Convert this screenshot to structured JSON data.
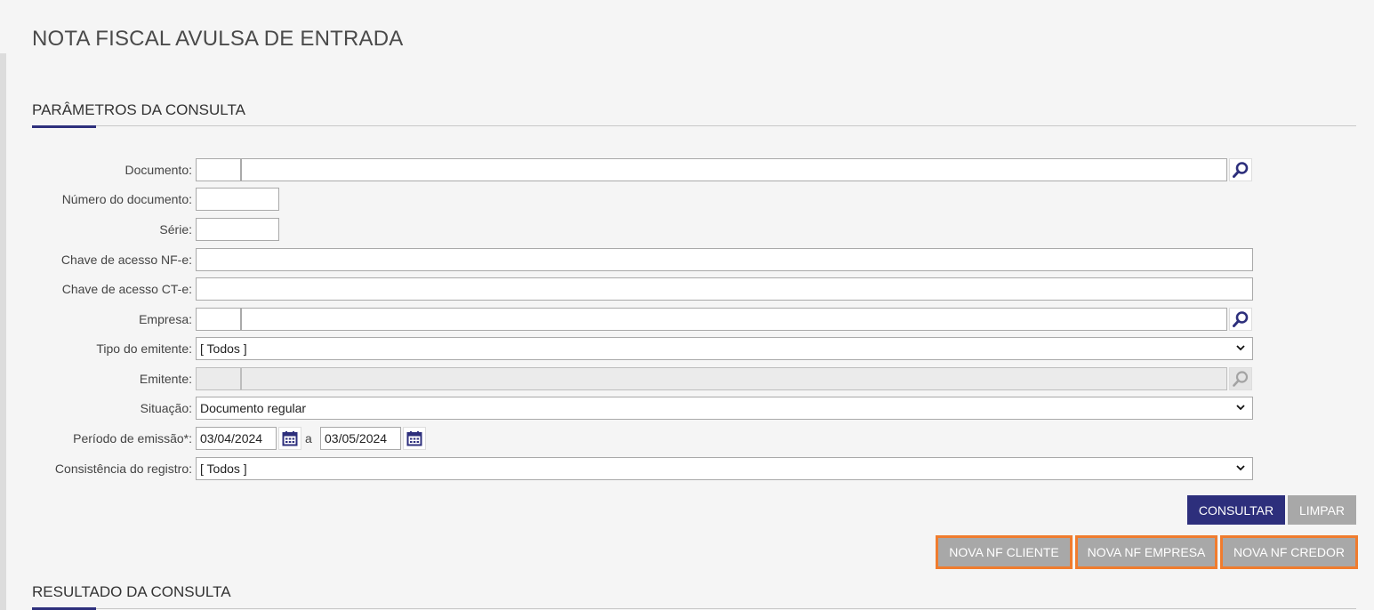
{
  "page": {
    "title": "NOTA FISCAL AVULSA DE ENTRADA"
  },
  "sections": {
    "params_title": "PARÂMETROS DA CONSULTA",
    "results_title": "RESULTADO DA CONSULTA"
  },
  "form": {
    "documento": {
      "label": "Documento:",
      "code": "",
      "value": ""
    },
    "numero": {
      "label": "Número do documento:",
      "value": ""
    },
    "serie": {
      "label": "Série:",
      "value": ""
    },
    "chave_nfe": {
      "label": "Chave de acesso NF-e:",
      "value": ""
    },
    "chave_cte": {
      "label": "Chave de acesso CT-e:",
      "value": ""
    },
    "empresa": {
      "label": "Empresa:",
      "code": "",
      "value": ""
    },
    "tipo_emitente": {
      "label": "Tipo do emitente:",
      "selected": "[ Todos ]"
    },
    "emitente": {
      "label": "Emitente:",
      "code": "",
      "value": ""
    },
    "situacao": {
      "label": "Situação:",
      "selected": "Documento regular"
    },
    "periodo": {
      "label": "Período de emissão*:",
      "from": "03/04/2024",
      "separator": "a",
      "to": "03/05/2024"
    },
    "consistencia": {
      "label": "Consistência do registro:",
      "selected": "[ Todos ]"
    }
  },
  "actions": {
    "consultar": "CONSULTAR",
    "limpar": "LIMPAR",
    "nova_cliente": "NOVA NF CLIENTE",
    "nova_empresa": "NOVA NF EMPRESA",
    "nova_credor": "NOVA NF CREDOR"
  },
  "icons": {
    "search": "magnifier-icon",
    "calendar": "calendar-icon",
    "dropdown": "chevron-down-icon"
  },
  "colors": {
    "primary": "#2d2f7c",
    "highlight": "#f07c2e",
    "gray_button": "#a8a8a8"
  }
}
